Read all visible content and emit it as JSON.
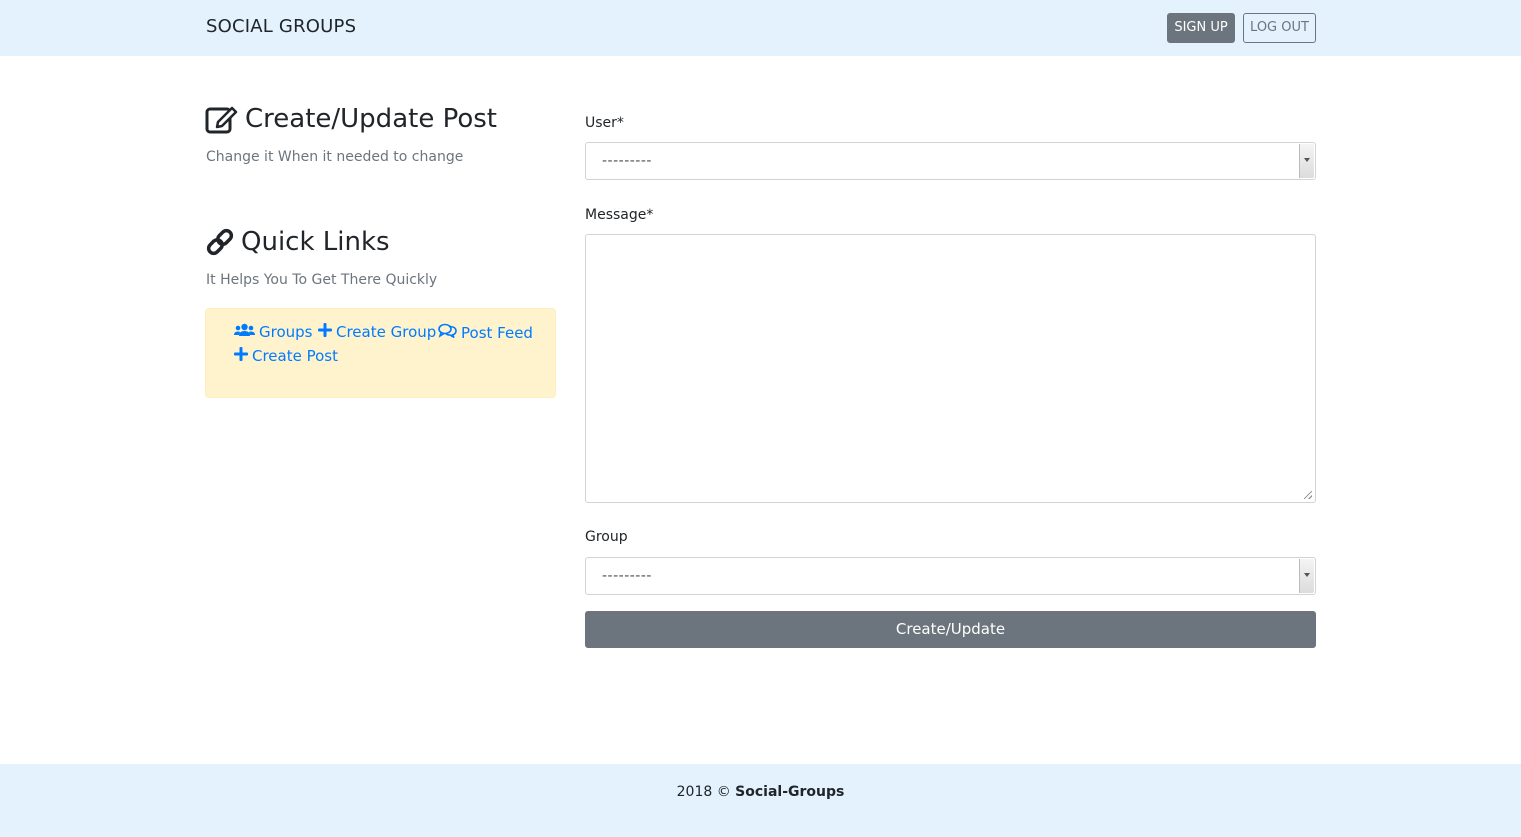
{
  "navbar": {
    "brand": "SOCIAL GROUPS",
    "signup_label": "SIGN UP",
    "logout_label": "LOG OUT"
  },
  "sidebar": {
    "create_title": "Create/Update Post",
    "create_subtitle": "Change it When it needed to change",
    "links_title": "Quick Links",
    "links_subtitle": "It Helps You To Get There Quickly",
    "links": [
      {
        "label": "Groups",
        "icon": "users-icon"
      },
      {
        "label": "Create Group",
        "icon": "plus-icon"
      },
      {
        "label": "Post Feed",
        "icon": "comments-icon"
      },
      {
        "label": "Create Post",
        "icon": "plus-icon"
      }
    ]
  },
  "form": {
    "user_label": "User*",
    "user_value": "---------",
    "message_label": "Message*",
    "message_value": "",
    "group_label": "Group",
    "group_value": "---------",
    "submit_label": "Create/Update"
  },
  "footer": {
    "year": "2018 ©",
    "site_name": "Social-Groups"
  },
  "colors": {
    "navbar_bg": "#e3f2fd",
    "link": "#007bff",
    "secondary": "#6c757d",
    "quicklinks_bg": "#fff3cd"
  }
}
